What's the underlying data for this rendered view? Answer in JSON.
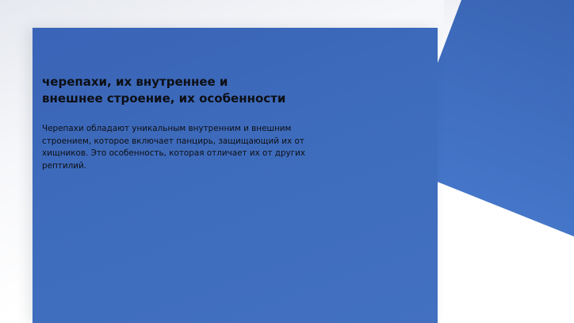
{
  "slide": {
    "title": "черепахи, их внутреннее и\nвнешнее строение, их особенности",
    "body": "Черепахи обладают уникальным внутренним и внешним строением, которое включает панцирь, защищающий их от хищников. Это особенность, которая отличает их от других рептилий."
  },
  "colors": {
    "card_blue": "#3f6dbd",
    "accent_blue": "#4576c9",
    "text": "#0d0f14",
    "background": "#ffffff"
  }
}
